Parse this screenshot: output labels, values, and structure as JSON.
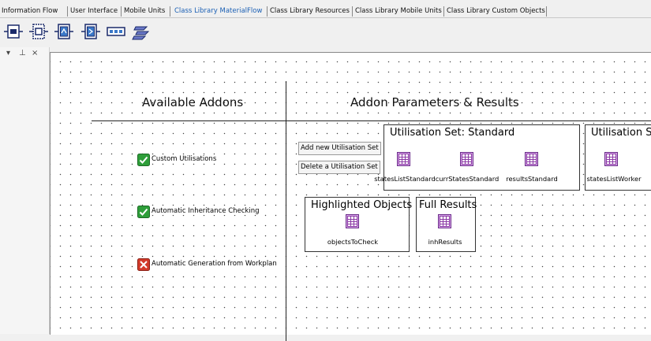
{
  "tabs": [
    {
      "label": "Information Flow",
      "active": false
    },
    {
      "label": "User Interface",
      "active": false
    },
    {
      "label": "Mobile Units",
      "active": false
    },
    {
      "label": "Class Library MaterialFlow",
      "active": true
    },
    {
      "label": "Class Library Resources",
      "active": false
    },
    {
      "label": "Class Library Mobile Units",
      "active": false
    },
    {
      "label": "Class Library Custom Objects",
      "active": false
    }
  ],
  "toolbar": {
    "buttons": [
      "source-icon",
      "connector-icon",
      "singleproc-icon",
      "parallelproc-icon",
      "line-icon",
      "flow-icon"
    ]
  },
  "dock": {
    "pin": "↓ p",
    "close": "×"
  },
  "canvas": {
    "available_addons_title": "Available Addons",
    "addon_params_title": "Addon Parameters & Results",
    "addons": [
      {
        "label": "Custom Utilisations",
        "state": "checked"
      },
      {
        "label": "Automatic Inheritance Checking",
        "state": "checked"
      },
      {
        "label": "Automatic Generation from Workplan",
        "state": "unchecked"
      }
    ],
    "add_button": "Add new Utilisation Set",
    "delete_button": "Delete a Utilisation Set",
    "util_standard": {
      "title": "Utilisation Set: Standard",
      "tables": [
        "statesListStandard",
        "currStatesStandard",
        "resultsStandard"
      ]
    },
    "util_worker": {
      "title": "Utilisation Se",
      "tables": [
        "statesListWorker"
      ]
    },
    "highlighted": {
      "title": "Highlighted Objects",
      "table": "objectsToCheck"
    },
    "full_results": {
      "title": "Full Results",
      "table": "inhResults"
    }
  },
  "colors": {
    "active_tab": "#1a5fb4",
    "check_green": "#2e9e3a",
    "check_red": "#d23a2a",
    "table_icon": "#8b3aa5"
  }
}
